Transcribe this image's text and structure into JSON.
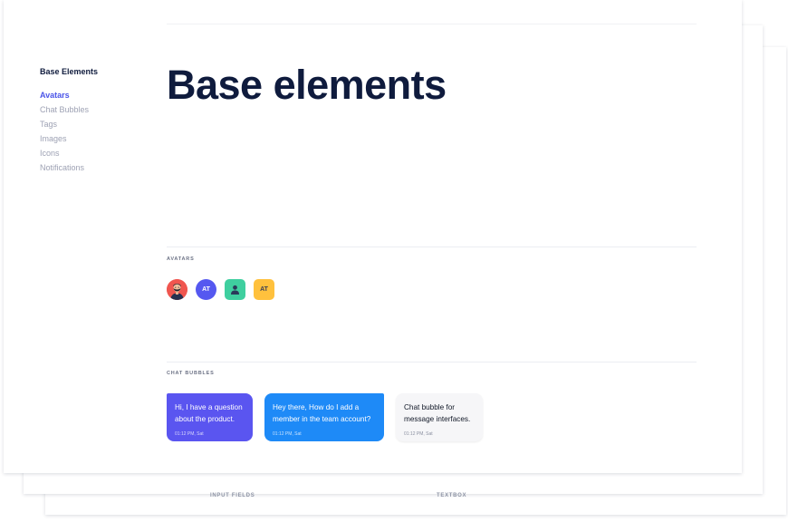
{
  "sidebar": {
    "title": "Base Elements",
    "items": [
      {
        "label": "Avatars"
      },
      {
        "label": "Chat Bubbles"
      },
      {
        "label": "Tags"
      },
      {
        "label": "Images"
      },
      {
        "label": "Icons"
      },
      {
        "label": "Notifications"
      }
    ]
  },
  "main": {
    "title": "Base elements",
    "sections": {
      "avatars": {
        "label": "AVATARS",
        "items": [
          {
            "kind": "photo",
            "text": ""
          },
          {
            "kind": "initials",
            "text": "AT"
          },
          {
            "kind": "user-icon",
            "text": ""
          },
          {
            "kind": "initials",
            "text": "AT"
          }
        ]
      },
      "chat_bubbles": {
        "label": "CHAT BUBBLES",
        "items": [
          {
            "text": "Hi, I have a question about the product.",
            "time": "01:12 PM, Sat"
          },
          {
            "text": "Hey there, How do I add a member in the team account?",
            "time": "01:12 PM, Sat"
          },
          {
            "text": "Chat bubble for message interfaces.",
            "time": "01:12 PM, Sat"
          }
        ]
      }
    }
  },
  "background_cards": {
    "labels": [
      "INPUT FIELDS",
      "TEXTBOX"
    ]
  },
  "colors": {
    "accent": "#4b55e8",
    "heading": "#0f1b3d",
    "bubble_purple": "#5a55f0",
    "bubble_blue": "#1e8af7",
    "avatar_red": "#f0564f",
    "avatar_green": "#3fcf9f",
    "avatar_yellow": "#ffc13d"
  }
}
